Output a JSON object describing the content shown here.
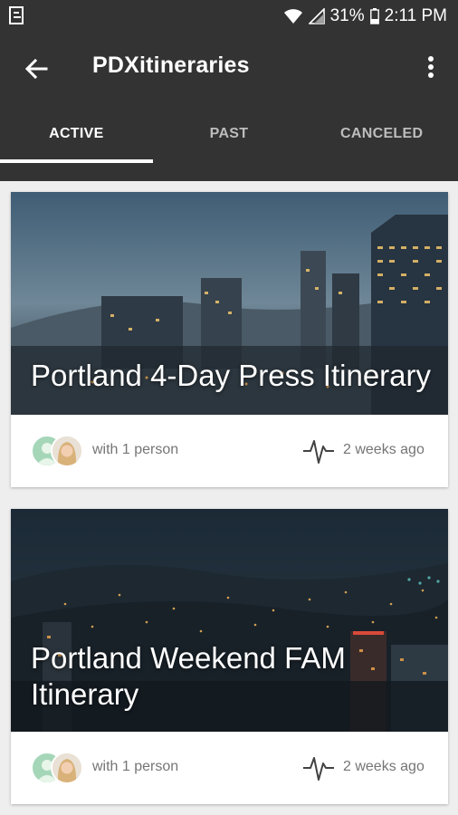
{
  "status_bar": {
    "battery": "31%",
    "time": "2:11 PM",
    "icons": [
      "notification-icon",
      "wifi-icon",
      "signal-icon",
      "battery-icon"
    ]
  },
  "app_bar": {
    "title": "PDXitineraries",
    "icons": [
      "back-arrow-icon",
      "more-vert-icon"
    ]
  },
  "tabs": [
    {
      "label": "ACTIVE",
      "active": true
    },
    {
      "label": "PAST",
      "active": false
    },
    {
      "label": "CANCELED",
      "active": false
    }
  ],
  "itineraries": [
    {
      "title": "Portland 4-Day Press Itinerary",
      "participants": "with 1 person",
      "updated": "2 weeks ago"
    },
    {
      "title": "Portland Weekend FAM Itinerary",
      "participants": "with 1 person",
      "updated": "2 weeks ago"
    }
  ],
  "colors": {
    "app_bar": "#333333",
    "background": "#eeeeee",
    "tab_active": "#ffffff",
    "tab_inactive": "#bdbdbd",
    "secondary_text": "#757575"
  }
}
